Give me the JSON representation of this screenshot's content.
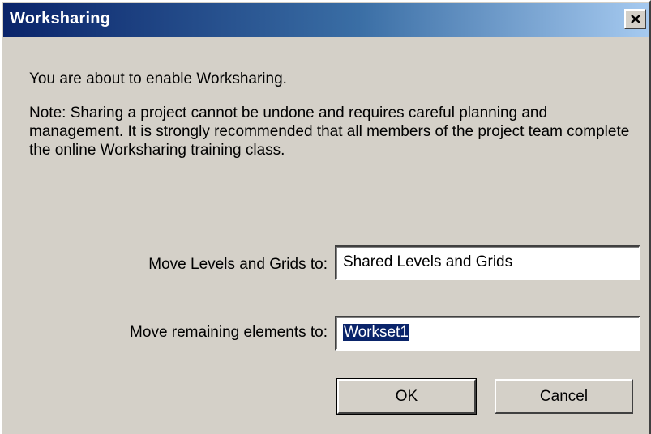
{
  "window": {
    "title": "Worksharing",
    "close_icon": "close-icon"
  },
  "message": {
    "line1": "You are about to enable Worksharing.",
    "note": "Note: Sharing a project cannot be undone and requires careful planning and management.  It is strongly recommended that all members of the project team complete the online Worksharing training class."
  },
  "fields": {
    "levels_label": "Move Levels and Grids to:",
    "levels_value": "Shared Levels and Grids",
    "remaining_label": "Move remaining elements to:",
    "remaining_value": "Workset1"
  },
  "buttons": {
    "ok": "OK",
    "cancel": "Cancel"
  },
  "colors": {
    "titlebar_start": "#0a246a",
    "titlebar_end": "#a6caf0",
    "dialog_bg": "#d4d0c8",
    "selection": "#0a246a"
  }
}
